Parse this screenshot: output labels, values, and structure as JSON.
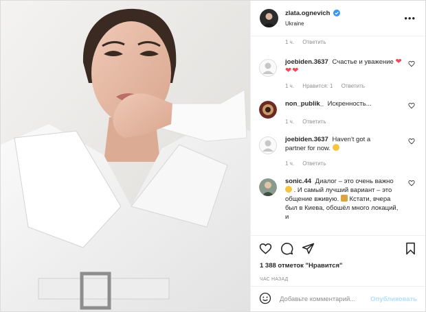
{
  "post": {
    "username": "zlata.ognevich",
    "location": "Ukraine",
    "more_label": "•••"
  },
  "top_reply": {
    "time": "1 ч.",
    "reply": "Ответить"
  },
  "comments": [
    {
      "user": "joebiden.3637",
      "text": "Счастье и уважение",
      "hearts": "❤❤❤",
      "time": "1 ч.",
      "likes": "Нравится: 1",
      "reply": "Ответить"
    },
    {
      "user": "non_publik_",
      "text": "Искренность...",
      "time": "1 ч.",
      "reply": "Ответить"
    },
    {
      "user": "joebiden.3637",
      "text": "Haven't got a partner for now.",
      "time": "1 ч.",
      "reply": "Ответить"
    },
    {
      "user": "sonic.44",
      "text_1": "Диалог – это очень важно",
      "text_2": ". И самый лучший вариант – это общение вживую.",
      "text_3": "Кстати, вчера был в Киева, обошёл много локаций, и"
    }
  ],
  "likes_text": "1 388 отметок \"Нравится\"",
  "time_ago": "ЧАС НАЗАД",
  "add_comment": {
    "placeholder": "Добавьте комментарий...",
    "publish": "Опубликовать"
  },
  "colors": {
    "accent": "#0095f6",
    "publish_disabled": "#b2dffc",
    "heart": "#ed4956"
  },
  "icons": [
    "heart-icon",
    "comment-icon",
    "share-icon",
    "bookmark-icon",
    "emoji-icon",
    "verified-icon",
    "more-icon"
  ]
}
